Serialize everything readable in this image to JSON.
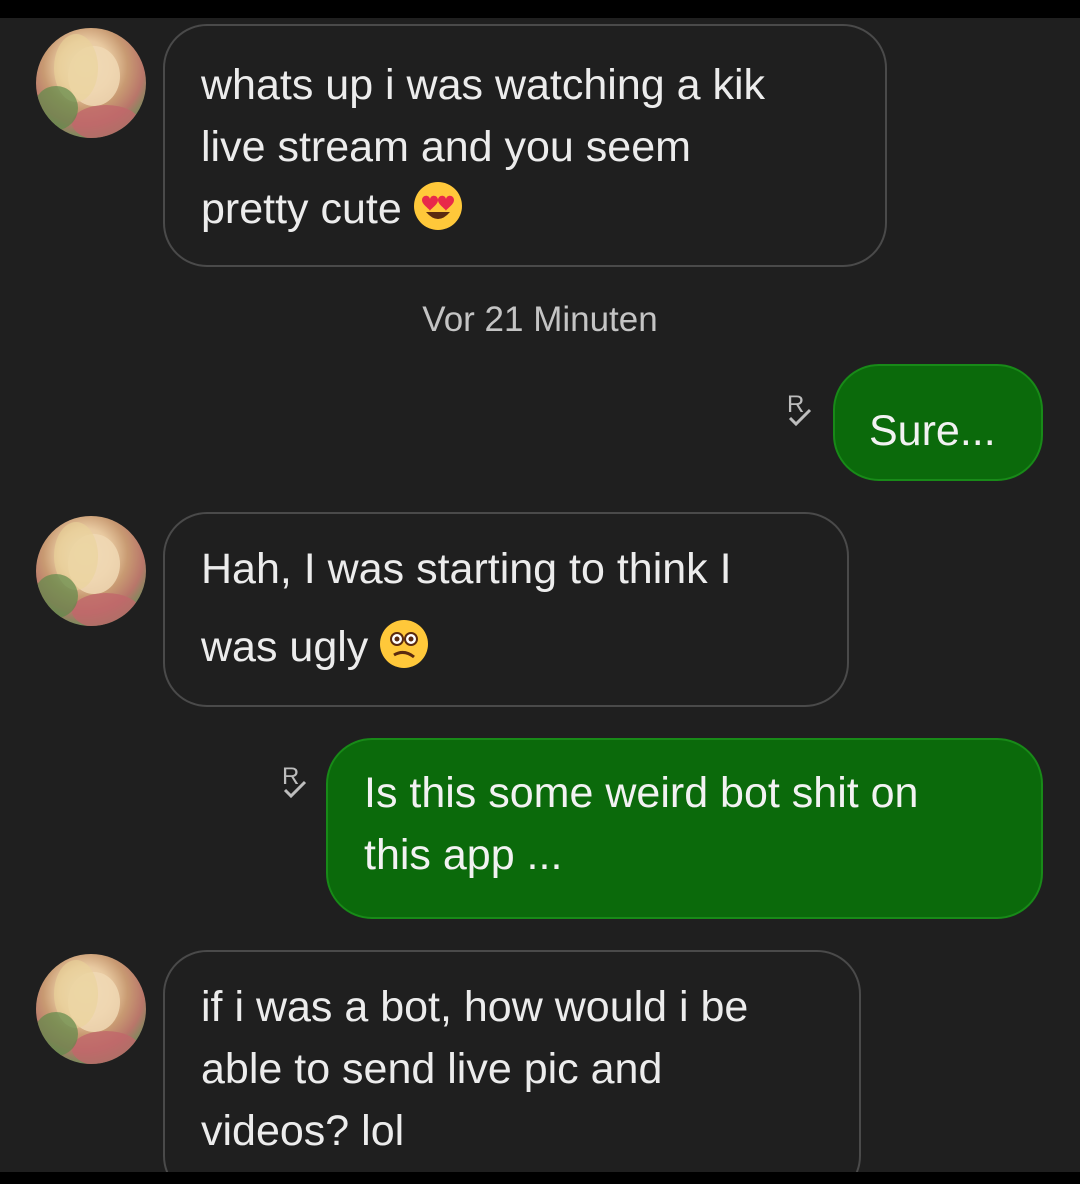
{
  "timestamp": "Vor 21 Minuten",
  "messages": [
    {
      "sender": "them",
      "lines": [
        "whats up i was watching a kik",
        "live stream and you seem",
        "pretty cute"
      ],
      "emoji": "heart-eyes-emoji"
    },
    {
      "sender": "me",
      "lines": [
        "Sure..."
      ],
      "receipt": "R"
    },
    {
      "sender": "them",
      "lines": [
        "Hah, I was starting to think I",
        "was ugly"
      ],
      "emoji": "confused-face-emoji"
    },
    {
      "sender": "me",
      "lines": [
        "Is this some weird bot shit on",
        "this app ..."
      ],
      "receipt": "R"
    },
    {
      "sender": "them",
      "lines": [
        "if i was a bot, how would i be",
        "able to send live pic and",
        "videos? lol"
      ]
    }
  ],
  "colors": {
    "background": "#1f1f1f",
    "incoming_border": "#4a4a4a",
    "outgoing_bubble": "#0b6a0b",
    "text": "#ececec"
  }
}
